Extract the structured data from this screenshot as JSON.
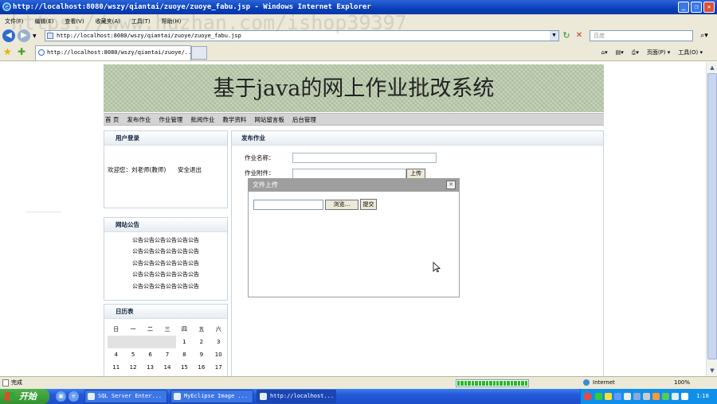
{
  "window": {
    "title": "http://localhost:8080/wszy/qiantai/zuoye/zuoye_fabu.jsp - Windows Internet Explorer",
    "min_symbol": "_",
    "max_symbol": "❐",
    "close_symbol": "✕"
  },
  "menubar": [
    "文件(F)",
    "编辑(E)",
    "查看(V)",
    "收藏夹(A)",
    "工具(T)",
    "帮助(H)"
  ],
  "address": {
    "url": "http://localhost:8080/wszy/qiantai/zuoye/zuoye_fabu.jsp",
    "search_placeholder": "百度"
  },
  "tab": {
    "title": "http://localhost:8080/wszy/qiantai/zuoye/..."
  },
  "toolbar": {
    "page_label": "页面(P) ▾",
    "tools_label": "工具(O) ▾"
  },
  "watermark": "https://www.huzhan.com/ishop39397",
  "site": {
    "banner_title": "基于java的网上作业批改系统",
    "nav": [
      "首 页",
      "发布作业",
      "作业管理",
      "批阅作业",
      "教学资料",
      "网站留言板",
      "后台管理"
    ]
  },
  "login": {
    "header": "用户登录",
    "welcome": "欢迎您：刘老师(教师)",
    "logout": "安全退出"
  },
  "notice": {
    "header": "网站公告",
    "items": [
      "公告公告公告公告公告公告",
      "公告公告公告公告公告公告",
      "公告公告公告公告公告公告",
      "公告公告公告公告公告公告",
      "公告公告公告公告公告公告"
    ]
  },
  "calendar": {
    "header": "日历表",
    "weekdays": [
      "日",
      "一",
      "二",
      "三",
      "四",
      "五",
      "六"
    ],
    "rows": [
      [
        "",
        "",
        "",
        "",
        "1",
        "2",
        "3"
      ],
      [
        "4",
        "5",
        "6",
        "7",
        "8",
        "9",
        "10"
      ],
      [
        "11",
        "12",
        "13",
        "14",
        "15",
        "16",
        "17"
      ]
    ]
  },
  "publish": {
    "header": "发布作业",
    "name_label": "作业名称：",
    "attachment_label": "作业附件：",
    "upload_button": "上传"
  },
  "dialog": {
    "title": "文件上传",
    "browse_button": "浏览...",
    "submit_button": "提交",
    "close_symbol": "✕"
  },
  "statusbar": {
    "status": "完成",
    "progress": 1.0,
    "zone": "Internet",
    "zoom": "100%"
  },
  "taskbar": {
    "start": "开始",
    "tasks": [
      "SQL Server Enter...",
      "MyEclipse Image ...",
      "http://localhost..."
    ],
    "clock": "1:18"
  }
}
